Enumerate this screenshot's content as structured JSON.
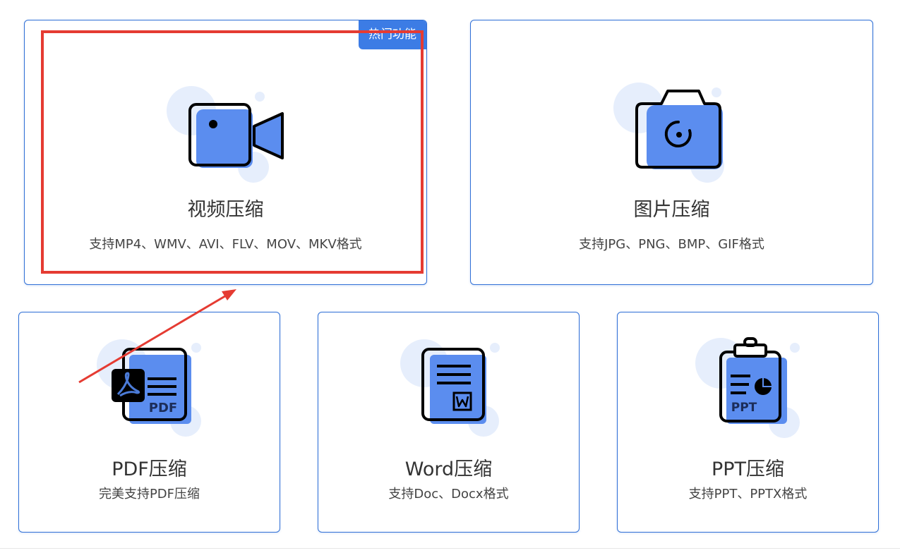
{
  "cards": {
    "video": {
      "title": "视频压缩",
      "desc": "支持MP4、WMV、AVI、FLV、MOV、MKV格式",
      "badge": "热门功能",
      "icon": "video-camera-icon"
    },
    "image": {
      "title": "图片压缩",
      "desc": "支持JPG、PNG、BMP、GIF格式",
      "icon": "camera-icon"
    },
    "pdf": {
      "title": "PDF压缩",
      "desc": "完美支持PDF压缩",
      "icon": "pdf-document-icon",
      "icon_label": "PDF"
    },
    "word": {
      "title": "Word压缩",
      "desc": "支持Doc、Docx格式",
      "icon": "word-document-icon"
    },
    "ppt": {
      "title": "PPT压缩",
      "desc": "支持PPT、PPTX格式",
      "icon": "ppt-clipboard-icon",
      "icon_label": "PPT"
    }
  },
  "colors": {
    "accent": "#5b8def",
    "accent_light": "#e6eefc",
    "card_border": "#2f6fd6",
    "badge": "#3c7ce5",
    "annotation": "#e53b32"
  }
}
